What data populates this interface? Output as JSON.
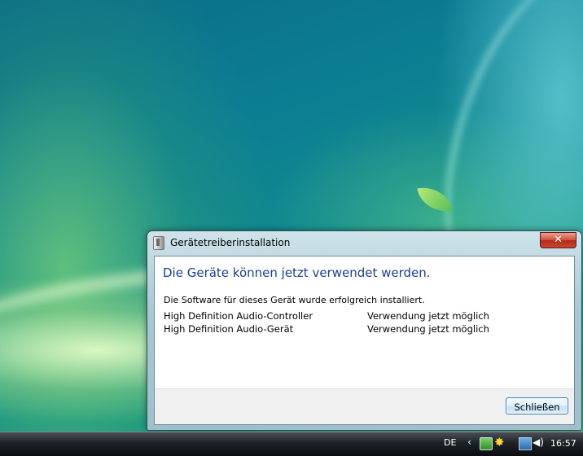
{
  "window": {
    "title": "Gerätetreiberinstallation",
    "close_glyph": "✕",
    "heading": "Die Geräte können jetzt verwendet werden.",
    "message": "Die Software für dieses Gerät wurde erfolgreich installiert.",
    "devices": [
      {
        "name": "High Definition Audio-Controller",
        "status": "Verwendung jetzt möglich"
      },
      {
        "name": "High Definition Audio-Gerät",
        "status": "Verwendung jetzt möglich"
      }
    ],
    "close_button_label": "Schließen"
  },
  "taskbar": {
    "language": "DE",
    "chevron": "‹",
    "tray_icons": [
      "sync-icon",
      "sun-icon",
      "network-icon",
      "volume-icon"
    ],
    "sun_glyph": "✸",
    "volume_glyph": "◀)",
    "clock": "16:57"
  },
  "colors": {
    "heading": "#1a3f8f",
    "close_red": "#c8462e",
    "button_border": "#3c7fb1"
  }
}
